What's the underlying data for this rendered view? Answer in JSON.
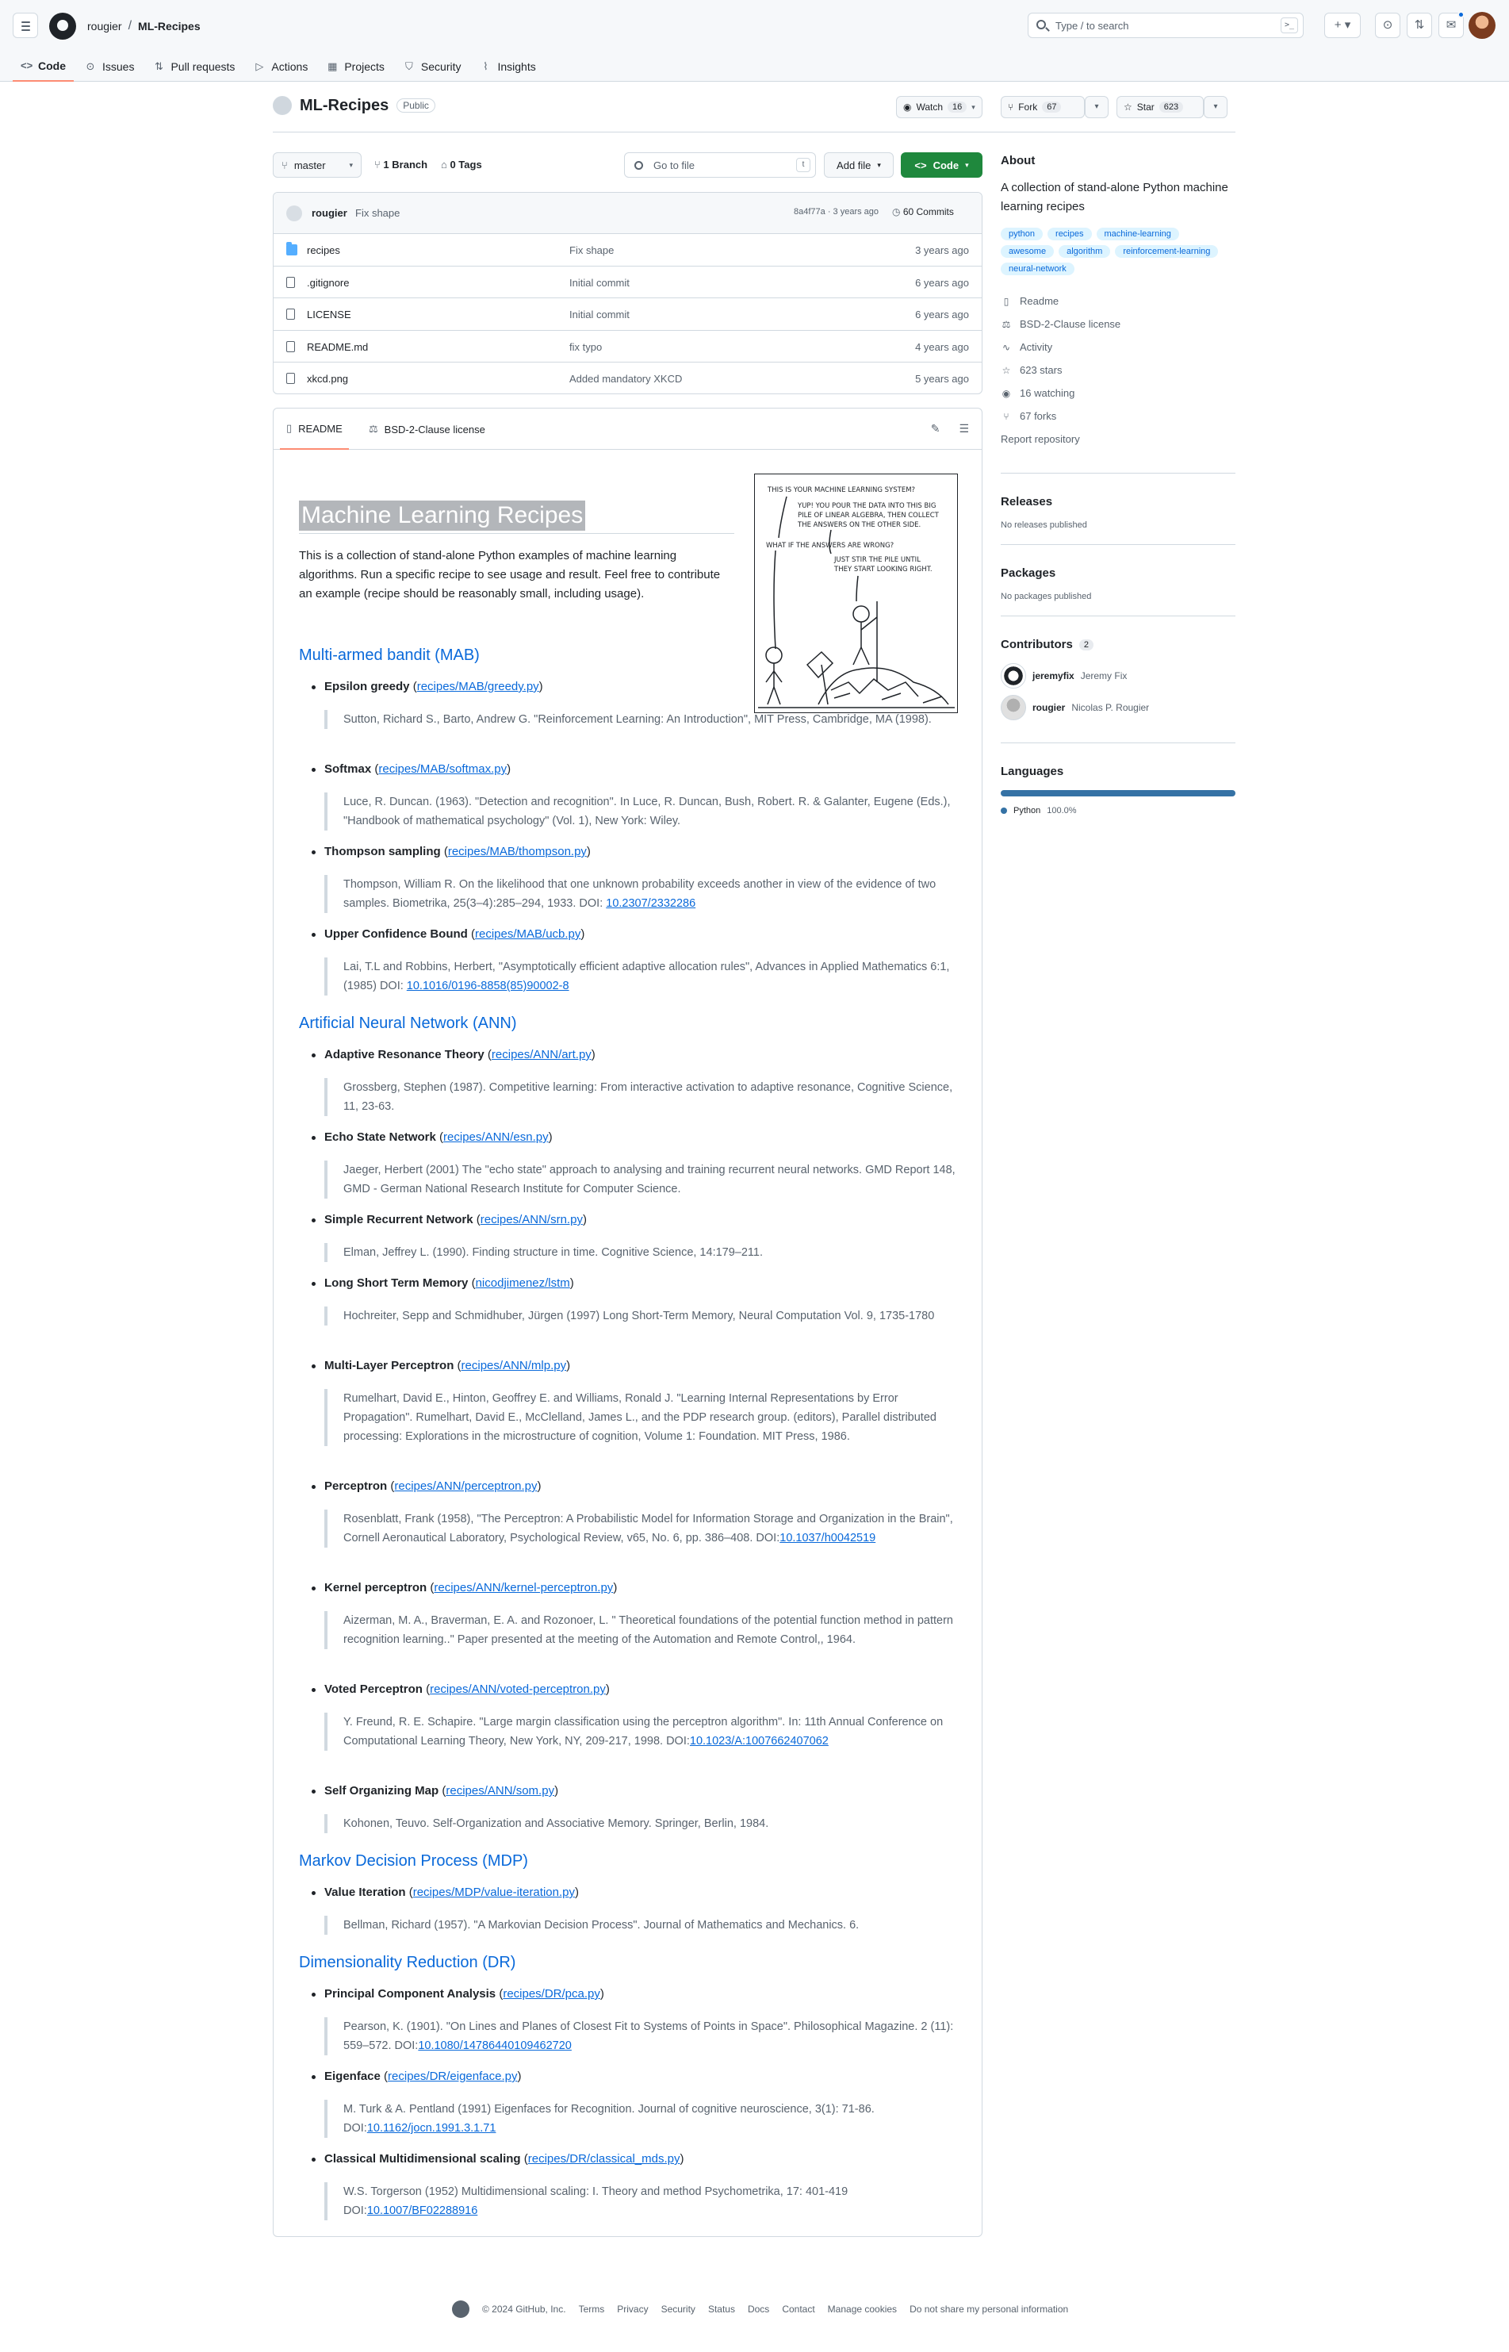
{
  "header": {
    "owner": "rougier",
    "repo": "ML-Recipes",
    "search_placeholder": "Type / to search",
    "search_shortcut": ">_"
  },
  "repo_nav": [
    {
      "label": "Code",
      "icon": "code-icon"
    },
    {
      "label": "Issues",
      "icon": "issue-icon"
    },
    {
      "label": "Pull requests",
      "icon": "pull-request-icon"
    },
    {
      "label": "Actions",
      "icon": "play-icon"
    },
    {
      "label": "Projects",
      "icon": "table-icon"
    },
    {
      "label": "Security",
      "icon": "shield-icon"
    },
    {
      "label": "Insights",
      "icon": "graph-icon"
    }
  ],
  "repo": {
    "name": "ML-Recipes",
    "visibility": "Public",
    "watch_label": "Watch",
    "watch_count": "16",
    "fork_label": "Fork",
    "fork_count": "67",
    "star_label": "Star",
    "star_count": "623"
  },
  "file_nav": {
    "branch": "master",
    "branches": "1 Branch",
    "tags": "0 Tags",
    "goto_placeholder": "Go to file",
    "goto_shortcut": "t",
    "add_file": "Add file",
    "code": "Code"
  },
  "last_commit": {
    "author": "rougier",
    "message": "Fix shape",
    "sha_time": "8a4f77a · 3 years ago",
    "commits": "60 Commits"
  },
  "files": [
    {
      "name": "recipes",
      "type": "folder",
      "message": "Fix shape",
      "age": "3 years ago"
    },
    {
      "name": ".gitignore",
      "type": "file",
      "message": "Initial commit",
      "age": "6 years ago"
    },
    {
      "name": "LICENSE",
      "type": "file",
      "message": "Initial commit",
      "age": "6 years ago"
    },
    {
      "name": "README.md",
      "type": "file",
      "message": "fix typo",
      "age": "4 years ago"
    },
    {
      "name": "xkcd.png",
      "type": "file",
      "message": "Added mandatory XKCD",
      "age": "5 years ago"
    }
  ],
  "readme_tabs": {
    "readme": "README",
    "license": "BSD-2-Clause license"
  },
  "readme": {
    "title": "Machine Learning Recipes",
    "intro": "This is a collection of stand-alone Python examples of machine learning algorithms. Run a specific recipe to see usage and result. Feel free to contribute an example (recipe should be reasonably small, including usage).",
    "xkcd": {
      "l1": "THIS IS YOUR MACHINE LEARNING SYSTEM?",
      "l2": "YUP! YOU POUR THE DATA INTO THIS BIG",
      "l3": "PILE OF LINEAR ALGEBRA, THEN COLLECT",
      "l4": "THE ANSWERS ON THE OTHER SIDE.",
      "l5": "WHAT IF THE ANSWERS ARE WRONG?",
      "l6": "JUST STIR THE PILE UNTIL",
      "l7": "THEY START LOOKING RIGHT."
    },
    "sections": [
      {
        "title": "Multi-armed bandit (MAB)",
        "items": [
          {
            "name": "Epsilon greedy",
            "link": "recipes/MAB/greedy.py",
            "ref": "Sutton, Richard S., Barto, Andrew G. \"Reinforcement Learning: An Introduction\", MIT Press, Cambridge, MA (1998).",
            "doi": ""
          },
          {
            "name": "Softmax",
            "link": "recipes/MAB/softmax.py",
            "ref": "Luce, R. Duncan. (1963). \"Detection and recognition\". In Luce, R. Duncan, Bush, Robert. R. & Galanter, Eugene (Eds.), \"Handbook of mathematical psychology\" (Vol. 1), New York: Wiley.",
            "doi": ""
          },
          {
            "name": "Thompson sampling",
            "link": "recipes/MAB/thompson.py",
            "ref": "Thompson, William R. On the likelihood that one unknown probability exceeds another in view of the evidence of two samples. Biometrika, 25(3–4):285–294, 1933. DOI:",
            "doi": "10.2307/2332286"
          },
          {
            "name": "Upper Confidence Bound",
            "link": "recipes/MAB/ucb.py",
            "ref": "Lai, T.L and Robbins, Herbert, \"Asymptotically efficient adaptive allocation rules\", Advances in Applied Mathematics 6:1, (1985) DOI:",
            "doi": "10.1016/0196-8858(85)90002-8"
          }
        ]
      },
      {
        "title": "Artificial Neural Network (ANN)",
        "items": [
          {
            "name": "Adaptive Resonance Theory",
            "link": "recipes/ANN/art.py",
            "ref": "Grossberg, Stephen (1987). Competitive learning: From interactive activation to adaptive resonance, Cognitive Science, 11, 23-63.",
            "doi": ""
          },
          {
            "name": "Echo State Network",
            "link": "recipes/ANN/esn.py",
            "ref": "Jaeger, Herbert (2001) The \"echo state\" approach to analysing and training recurrent neural networks. GMD Report 148, GMD - German National Research Institute for Computer Science.",
            "doi": ""
          },
          {
            "name": "Simple Recurrent Network",
            "link": "recipes/ANN/srn.py",
            "ref": "Elman, Jeffrey L. (1990). Finding structure in time. Cognitive Science, 14:179–211.",
            "doi": ""
          },
          {
            "name": "Long Short Term Memory",
            "link": "nicodjimenez/lstm",
            "ref": "Hochreiter, Sepp and Schmidhuber, Jürgen (1997) Long Short-Term Memory, Neural Computation Vol. 9, 1735-1780",
            "doi": ""
          },
          {
            "name": "Multi-Layer Perceptron",
            "link": "recipes/ANN/mlp.py",
            "ref": "Rumelhart, David E., Hinton, Geoffrey E. and Williams, Ronald J. \"Learning Internal Representations by Error Propagation\". Rumelhart, David E., McClelland, James L., and the PDP research group. (editors), Parallel distributed processing: Explorations in the microstructure of cognition, Volume 1: Foundation. MIT Press, 1986.",
            "doi": ""
          },
          {
            "name": "Perceptron",
            "link": "recipes/ANN/perceptron.py",
            "ref": "Rosenblatt, Frank (1958), \"The Perceptron: A Probabilistic Model for Information Storage and Organization in the Brain\", Cornell Aeronautical Laboratory, Psychological Review, v65, No. 6, pp. 386–408. DOI:",
            "doi": "10.1037/h0042519"
          },
          {
            "name": "Kernel perceptron",
            "link": "recipes/ANN/kernel-perceptron.py",
            "ref": "Aizerman, M. A., Braverman, E. A. and Rozonoer, L. \" Theoretical foundations of the potential function method in pattern recognition learning..\" Paper presented at the meeting of the Automation and Remote Control,, 1964.",
            "doi": ""
          },
          {
            "name": "Voted Perceptron",
            "link": "recipes/ANN/voted-perceptron.py",
            "ref": "Y. Freund, R. E. Schapire. \"Large margin classification using the perceptron algorithm\". In: 11th Annual Conference on Computational Learning Theory, New York, NY, 209-217, 1998. DOI:",
            "doi": "10.1023/A:1007662407062"
          },
          {
            "name": "Self Organizing Map",
            "link": "recipes/ANN/som.py",
            "ref": "Kohonen, Teuvo. Self-Organization and Associative Memory. Springer, Berlin, 1984.",
            "doi": ""
          }
        ]
      },
      {
        "title": "Markov Decision Process (MDP)",
        "items": [
          {
            "name": "Value Iteration",
            "link": "recipes/MDP/value-iteration.py",
            "ref": "Bellman, Richard (1957). \"A Markovian Decision Process\". Journal of Mathematics and Mechanics. 6.",
            "doi": ""
          }
        ]
      },
      {
        "title": "Dimensionality Reduction (DR)",
        "items": [
          {
            "name": "Principal Component Analysis",
            "link": "recipes/DR/pca.py",
            "ref": "Pearson, K. (1901). \"On Lines and Planes of Closest Fit to Systems of Points in Space\". Philosophical Magazine. 2 (11): 559–572. DOI:",
            "doi": "10.1080/14786440109462720"
          },
          {
            "name": "Eigenface",
            "link": "recipes/DR/eigenface.py",
            "ref": "M. Turk & A. Pentland (1991) Eigenfaces for Recognition. Journal of cognitive neuroscience, 3(1): 71-86. DOI:",
            "doi": "10.1162/jocn.1991.3.1.71"
          },
          {
            "name": "Classical Multidimensional scaling",
            "link": "recipes/DR/classical_mds.py",
            "ref": "W.S. Torgerson (1952) Multidimensional scaling: I. Theory and method Psychometrika, 17: 401-419 DOI:",
            "doi": "10.1007/BF02288916"
          }
        ]
      }
    ]
  },
  "sidebar": {
    "about_title": "About",
    "description": "A collection of stand-alone Python machine learning recipes",
    "topics": [
      "python",
      "recipes",
      "machine-learning",
      "awesome",
      "algorithm",
      "reinforcement-learning",
      "neural-network"
    ],
    "links": [
      {
        "label": "Readme",
        "icon": "book-icon"
      },
      {
        "label": "BSD-2-Clause license",
        "icon": "law-icon"
      },
      {
        "label": "Activity",
        "icon": "pulse-icon"
      },
      {
        "label": "623 stars",
        "icon": "star-icon"
      },
      {
        "label": "16 watching",
        "icon": "eye-icon"
      },
      {
        "label": "67 forks",
        "icon": "fork-icon"
      }
    ],
    "report": "Report repository",
    "releases_title": "Releases",
    "releases_text": "No releases published",
    "packages_title": "Packages",
    "packages_text": "No packages published",
    "contributors_title": "Contributors",
    "contributors_count": "2",
    "contributors": [
      {
        "login": "jeremyfix",
        "name": "Jeremy Fix"
      },
      {
        "login": "rougier",
        "name": "Nicolas P. Rougier"
      }
    ],
    "languages_title": "Languages",
    "language": "Python",
    "language_pct": "100.0%",
    "language_share": 1.0,
    "language_color": "#3572a5"
  },
  "footer": {
    "copyright": "© 2024 GitHub, Inc.",
    "links": [
      "Terms",
      "Privacy",
      "Security",
      "Status",
      "Docs",
      "Contact",
      "Manage cookies",
      "Do not share my personal information"
    ]
  }
}
